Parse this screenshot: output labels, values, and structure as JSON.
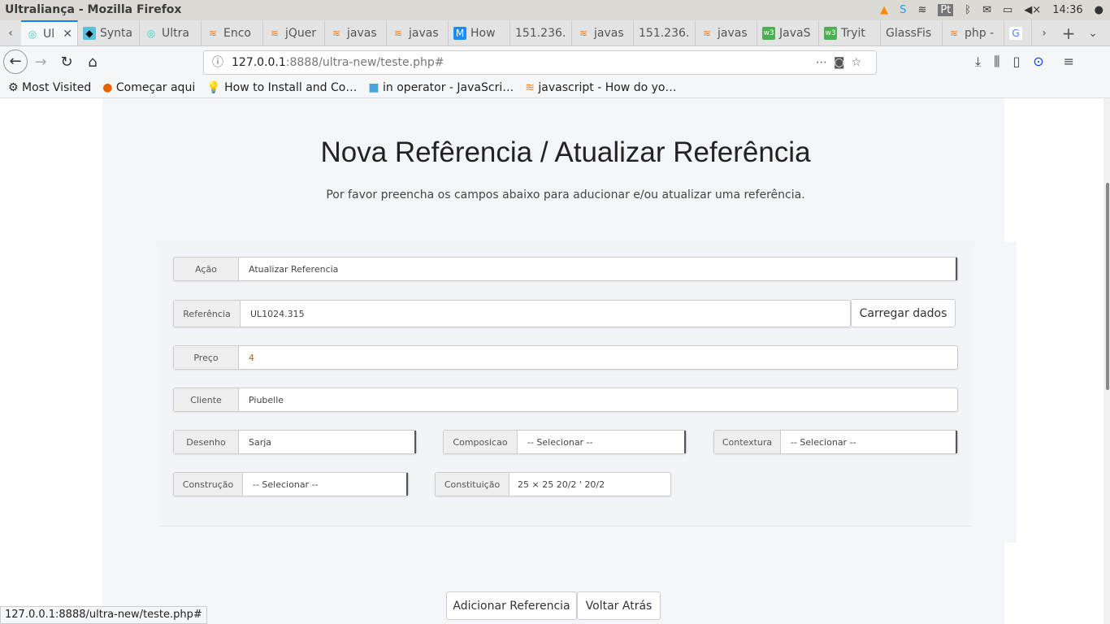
{
  "window": {
    "title": "Ultraliança - Mozilla Firefox",
    "lang": "Pt",
    "time": "14:36"
  },
  "tabs": [
    {
      "label": "Ul",
      "icon": "ultra-icon",
      "active": true
    },
    {
      "label": "Synta",
      "icon": "bird-icon"
    },
    {
      "label": "Ultra",
      "icon": "ultra-icon"
    },
    {
      "label": "Enco",
      "icon": "stackoverflow-icon"
    },
    {
      "label": "jQuer",
      "icon": "stackoverflow-icon"
    },
    {
      "label": "javas",
      "icon": "stackoverflow-icon"
    },
    {
      "label": "javas",
      "icon": "stackoverflow-icon"
    },
    {
      "label": "How",
      "icon": "m-icon"
    },
    {
      "label": "151.236.",
      "icon": ""
    },
    {
      "label": "javas",
      "icon": "stackoverflow-icon"
    },
    {
      "label": "151.236.",
      "icon": ""
    },
    {
      "label": "javas",
      "icon": "stackoverflow-icon"
    },
    {
      "label": "JavaS",
      "icon": "w3-icon"
    },
    {
      "label": "Tryit",
      "icon": "w3-icon"
    },
    {
      "label": "GlassFis",
      "icon": ""
    },
    {
      "label": "php -",
      "icon": "stackoverflow-icon"
    },
    {
      "label": "",
      "icon": "google-icon"
    }
  ],
  "url": {
    "host": "127.0.0.1",
    "rest": ":8888/ultra-new/teste.php#"
  },
  "bookmarks": [
    "Most Visited",
    "Começar aqui",
    "How to Install and Co…",
    "in operator - JavaScri…",
    "javascript - How do yo…"
  ],
  "page": {
    "title": "Nova Refêrencia / Atualizar Referência",
    "subtitle": "Por favor preencha os campos abaixo para aducionar e/ou atualizar uma referência.",
    "fields": {
      "acao": {
        "label": "Ação",
        "value": "Atualizar Referencia"
      },
      "referencia": {
        "label": "Referência",
        "value": "UL1024.315",
        "button": "Carregar dados"
      },
      "preco": {
        "label": "Preço",
        "value": "4"
      },
      "cliente": {
        "label": "Cliente",
        "value": "Piubelle"
      },
      "desenho": {
        "label": "Desenho",
        "value": "Sarja"
      },
      "composicao": {
        "label": "Composicao",
        "value": "-- Selecionar --"
      },
      "contextura": {
        "label": "Contextura",
        "value": "-- Selecionar --"
      },
      "construcao": {
        "label": "Construção",
        "value": "-- Selecionar --"
      },
      "constituicao": {
        "label": "Constituição",
        "value": "25 × 25 20/2 ' 20/2"
      }
    },
    "buttons": {
      "add": "Adicionar Referencia",
      "back": "Voltar Atrás"
    }
  },
  "status_url": "127.0.0.1:8888/ultra-new/teste.php#"
}
